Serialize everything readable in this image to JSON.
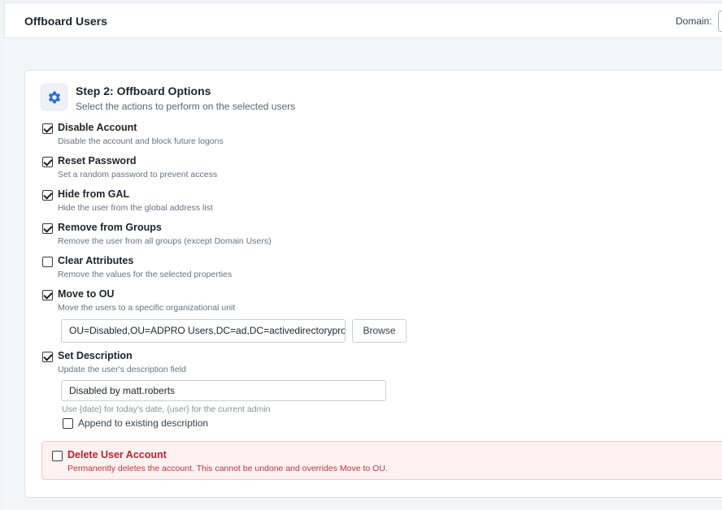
{
  "header": {
    "title": "Offboard Users",
    "domain_label": "Domain:"
  },
  "step": {
    "title": "Step 2: Offboard Options",
    "subtitle": "Select the actions to perform on the selected users",
    "icon": "gear-icon"
  },
  "options": [
    {
      "label": "Disable Account",
      "desc": "Disable the account and block future logons",
      "checked": true
    },
    {
      "label": "Reset Password",
      "desc": "Set a random password to prevent access",
      "checked": true
    },
    {
      "label": "Hide from GAL",
      "desc": "Hide the user from the global address list",
      "checked": true
    },
    {
      "label": "Remove from Groups",
      "desc": "Remove the user from all groups (except Domain Users)",
      "checked": true
    },
    {
      "label": "Clear Attributes",
      "desc": "Remove the values for the selected properties",
      "checked": false
    },
    {
      "label": "Move to OU",
      "desc": "Move the users to a specific organizational unit",
      "checked": true
    },
    {
      "label": "Set Description",
      "desc": "Update the user's description field",
      "checked": true
    }
  ],
  "move_ou": {
    "value": "OU=Disabled,OU=ADPRO Users,DC=ad,DC=activedirectorypro,",
    "browse_label": "Browse"
  },
  "description": {
    "value": "Disabled by matt.roberts",
    "hint": "Use {date} for today's date, {user} for the current admin",
    "append_label": "Append to existing description",
    "append_checked": false
  },
  "delete": {
    "label": "Delete User Account",
    "desc": "Permanently deletes the account. This cannot be undone and overrides Move to OU.",
    "checked": false
  },
  "colors": {
    "accent": "#2a6fdb",
    "danger": "#b3262f",
    "danger_bg": "#fdf1f2"
  }
}
